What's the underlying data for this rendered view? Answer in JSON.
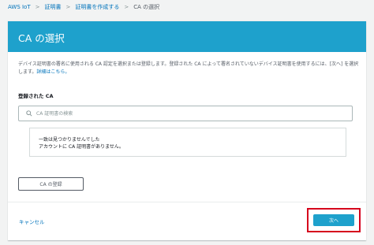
{
  "breadcrumb": {
    "items": [
      "AWS IoT",
      "証明書",
      "証明書を作成する"
    ],
    "current": "CA の選択",
    "separator": ">"
  },
  "panel": {
    "title": "CA の選択",
    "description": "デバイス証明書の署名に使用される CA 認定を選択または登録します。登録された CA によって署名されていないデバイス証明書を使用するには、[次へ] を選択します。",
    "help_link": "詳細はこちら。",
    "section_label": "登録された CA",
    "search": {
      "placeholder": "CA 証明書の検索",
      "value": ""
    },
    "empty_state": {
      "title": "一致は見つかりませんでした",
      "message": "アカウントに CA 証明書がありません。"
    },
    "register_button": "CA の登録"
  },
  "footer": {
    "cancel": "キャンセル",
    "next": "次へ"
  },
  "colors": {
    "header_bg": "#1ea1cc",
    "primary_button": "#1ea1cc",
    "link": "#0073bb",
    "highlight_frame": "#d6001c"
  }
}
